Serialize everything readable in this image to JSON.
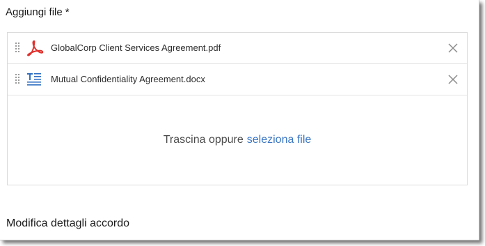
{
  "add_files": {
    "title": "Aggiungi file",
    "required_marker": "*"
  },
  "files": [
    {
      "name": "GlobalCorp Client Services Agreement.pdf",
      "icon": "pdf-icon",
      "icon_color": "#e0302c"
    },
    {
      "name": "Mutual Confidentiality Agreement.docx",
      "icon": "document-text-icon",
      "icon_color": "#2f6fc2"
    }
  ],
  "drop_zone": {
    "prompt": "Trascina oppure",
    "link": "seleziona file"
  },
  "agreement_details": {
    "title": "Modifica dettagli accordo"
  },
  "colors": {
    "link": "#3a76c4",
    "border": "#dadada",
    "text": "#2c2c2c"
  }
}
